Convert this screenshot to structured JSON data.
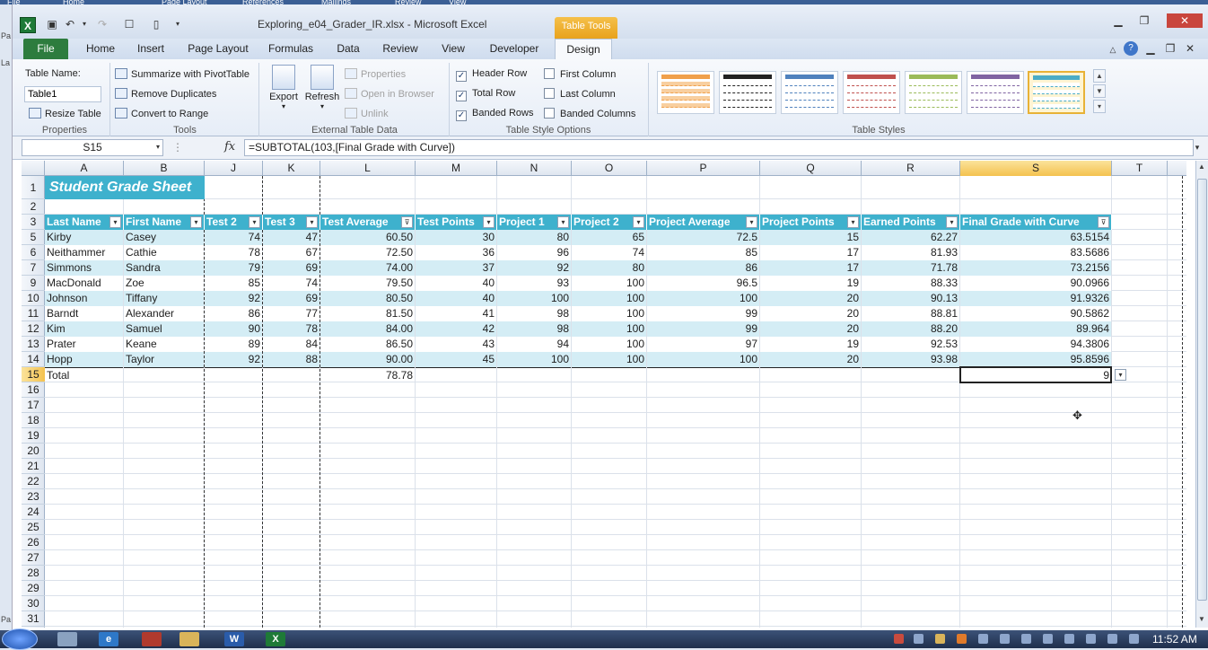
{
  "outer_strip": {
    "tabs": [
      "File",
      "Home",
      "Page Layout",
      "References",
      "Mailings",
      "Review",
      "View"
    ]
  },
  "left_strip": [
    "Pa",
    "La",
    "Pa"
  ],
  "titlebar": {
    "title": "Exploring_e04_Grader_IR.xlsx - Microsoft Excel",
    "contextual_tab": "Table Tools",
    "app_icon_letter": "X"
  },
  "tabs": [
    "File",
    "Home",
    "Insert",
    "Page Layout",
    "Formulas",
    "Data",
    "Review",
    "View",
    "Developer",
    "Design"
  ],
  "ribbon": {
    "properties": {
      "label": "Properties",
      "table_name_label": "Table Name:",
      "table_name_value": "Table1",
      "resize": "Resize Table"
    },
    "tools": {
      "label": "Tools",
      "summarize": "Summarize with PivotTable",
      "remove_dup": "Remove Duplicates",
      "convert": "Convert to Range"
    },
    "external": {
      "label": "External Table Data",
      "export": "Export",
      "refresh": "Refresh",
      "properties": "Properties",
      "open_browser": "Open in Browser",
      "unlink": "Unlink"
    },
    "style_options": {
      "label": "Table Style Options",
      "header_row": "Header Row",
      "total_row": "Total Row",
      "banded_rows": "Banded Rows",
      "first_column": "First Column",
      "last_column": "Last Column",
      "banded_columns": "Banded Columns"
    },
    "styles": {
      "label": "Table Styles",
      "swatch_colors": [
        "#f0a04b",
        "#222222",
        "#4f81bd",
        "#c0504d",
        "#9bbb59",
        "#8064a2",
        "#4bacc6"
      ]
    }
  },
  "formula": {
    "name_box": "S15",
    "fx": "fx",
    "content": "=SUBTOTAL(103,[Final Grade with Curve])"
  },
  "columns": [
    "A",
    "B",
    "J",
    "K",
    "L",
    "M",
    "N",
    "O",
    "P",
    "Q",
    "R",
    "S",
    "T"
  ],
  "selected_column": "S",
  "rows": [
    "1",
    "2",
    "3",
    "5",
    "6",
    "7",
    "9",
    "10",
    "11",
    "12",
    "13",
    "14",
    "15",
    "16",
    "17",
    "18",
    "19",
    "20",
    "21",
    "22",
    "23",
    "24",
    "25",
    "26",
    "27",
    "28",
    "29",
    "30",
    "31"
  ],
  "selected_row": "15",
  "sheet_title": "Student Grade Sheet",
  "table": {
    "headers": [
      "Last Name",
      "First Name",
      "Test 2",
      "Test 3",
      "Test Average",
      "Test Points",
      "Project 1",
      "Project 2",
      "Project Average",
      "Project Points",
      "Earned Points",
      "Final Grade with Curve"
    ],
    "rows": [
      [
        "Kirby",
        "Casey",
        "74",
        "47",
        "60.50",
        "30",
        "80",
        "65",
        "72.5",
        "15",
        "62.27",
        "63.5154"
      ],
      [
        "Neithammer",
        "Cathie",
        "78",
        "67",
        "72.50",
        "36",
        "96",
        "74",
        "85",
        "17",
        "81.93",
        "83.5686"
      ],
      [
        "Simmons",
        "Sandra",
        "79",
        "69",
        "74.00",
        "37",
        "92",
        "80",
        "86",
        "17",
        "71.78",
        "73.2156"
      ],
      [
        "MacDonald",
        "Zoe",
        "85",
        "74",
        "79.50",
        "40",
        "93",
        "100",
        "96.5",
        "19",
        "88.33",
        "90.0966"
      ],
      [
        "Johnson",
        "Tiffany",
        "92",
        "69",
        "80.50",
        "40",
        "100",
        "100",
        "100",
        "20",
        "90.13",
        "91.9326"
      ],
      [
        "Barndt",
        "Alexander",
        "86",
        "77",
        "81.50",
        "41",
        "98",
        "100",
        "99",
        "20",
        "88.81",
        "90.5862"
      ],
      [
        "Kim",
        "Samuel",
        "90",
        "78",
        "84.00",
        "42",
        "98",
        "100",
        "99",
        "20",
        "88.20",
        "89.964"
      ],
      [
        "Prater",
        "Keane",
        "89",
        "84",
        "86.50",
        "43",
        "94",
        "100",
        "97",
        "19",
        "92.53",
        "94.3806"
      ],
      [
        "Hopp",
        "Taylor",
        "92",
        "88",
        "90.00",
        "45",
        "100",
        "100",
        "100",
        "20",
        "93.98",
        "95.8596"
      ]
    ],
    "total": {
      "label": "Total",
      "test_average": "78.78",
      "final_grade": "9"
    }
  },
  "taskbar": {
    "clock": "11:52 AM"
  }
}
